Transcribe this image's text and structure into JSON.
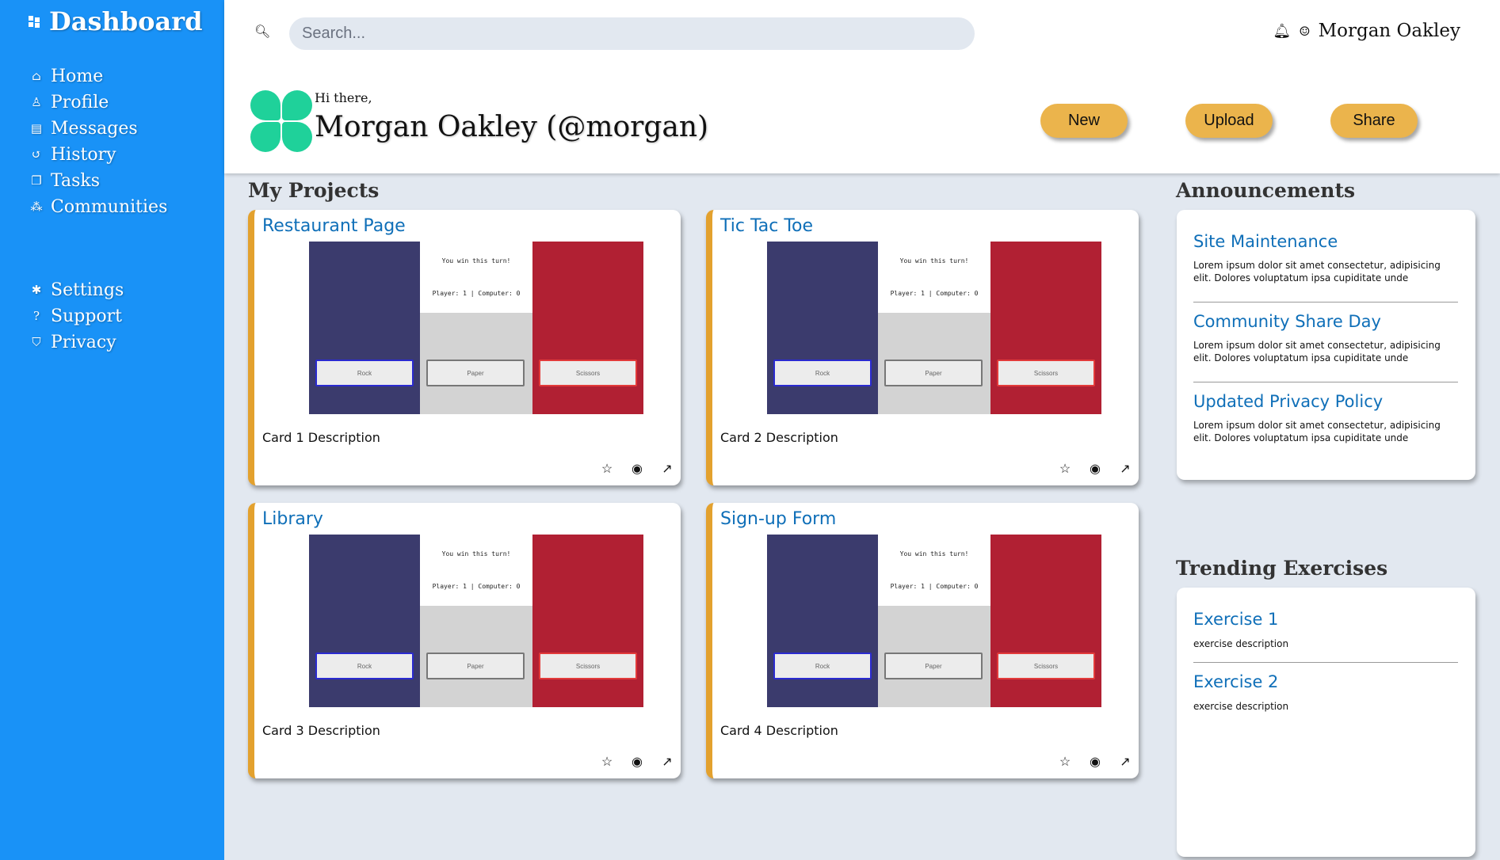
{
  "sidebar": {
    "title": "Dashboard",
    "nav_main": [
      {
        "label": "Home",
        "icon": "home-icon",
        "glyph": "⌂"
      },
      {
        "label": "Profile",
        "icon": "profile-icon",
        "glyph": "♙"
      },
      {
        "label": "Messages",
        "icon": "messages-icon",
        "glyph": "▤"
      },
      {
        "label": "History",
        "icon": "history-icon",
        "glyph": "↺"
      },
      {
        "label": "Tasks",
        "icon": "tasks-icon",
        "glyph": "❐"
      },
      {
        "label": "Communities",
        "icon": "communities-icon",
        "glyph": "⁂"
      }
    ],
    "nav_secondary": [
      {
        "label": "Settings",
        "icon": "gear-icon",
        "glyph": "✱"
      },
      {
        "label": "Support",
        "icon": "help-icon",
        "glyph": "?"
      },
      {
        "label": "Privacy",
        "icon": "shield-icon",
        "glyph": "⛉"
      }
    ]
  },
  "header": {
    "search_placeholder": "Search...",
    "user_name": "Morgan Oakley",
    "greeting": "Hi there,",
    "display_name": "Morgan Oakley (@morgan)",
    "buttons": {
      "new": "New",
      "upload": "Upload",
      "share": "Share"
    }
  },
  "projects": {
    "heading": "My Projects",
    "preview": {
      "status": "You win this turn!",
      "score": "Player: 1 | Computer: 0",
      "rock": "Rock",
      "paper": "Paper",
      "scissors": "Scissors"
    },
    "cards": [
      {
        "title": "Restaurant Page",
        "description": "Card 1 Description"
      },
      {
        "title": "Tic Tac Toe",
        "description": "Card 2 Description"
      },
      {
        "title": "Library",
        "description": "Card 3 Description"
      },
      {
        "title": "Sign-up Form",
        "description": "Card 4 Description"
      }
    ]
  },
  "announcements": {
    "heading": "Announcements",
    "items": [
      {
        "title": "Site Maintenance",
        "body": "Lorem ipsum dolor sit amet consectetur, adipisicing elit. Dolores voluptatum ipsa cupiditate unde"
      },
      {
        "title": "Community Share Day",
        "body": "Lorem ipsum dolor sit amet consectetur, adipisicing elit. Dolores voluptatum ipsa cupiditate unde"
      },
      {
        "title": "Updated Privacy Policy",
        "body": "Lorem ipsum dolor sit amet consectetur, adipisicing elit. Dolores voluptatum ipsa cupiditate unde"
      }
    ]
  },
  "trending": {
    "heading": "Trending Exercises",
    "items": [
      {
        "title": "Exercise 1",
        "body": "exercise description"
      },
      {
        "title": "Exercise 2",
        "body": "exercise description"
      }
    ]
  },
  "colors": {
    "sidebar": "#1992f7",
    "accent_button": "#ebb44c",
    "card_border": "#e3a12e",
    "link": "#0f6fb8",
    "avatar": "#1fd19a"
  }
}
